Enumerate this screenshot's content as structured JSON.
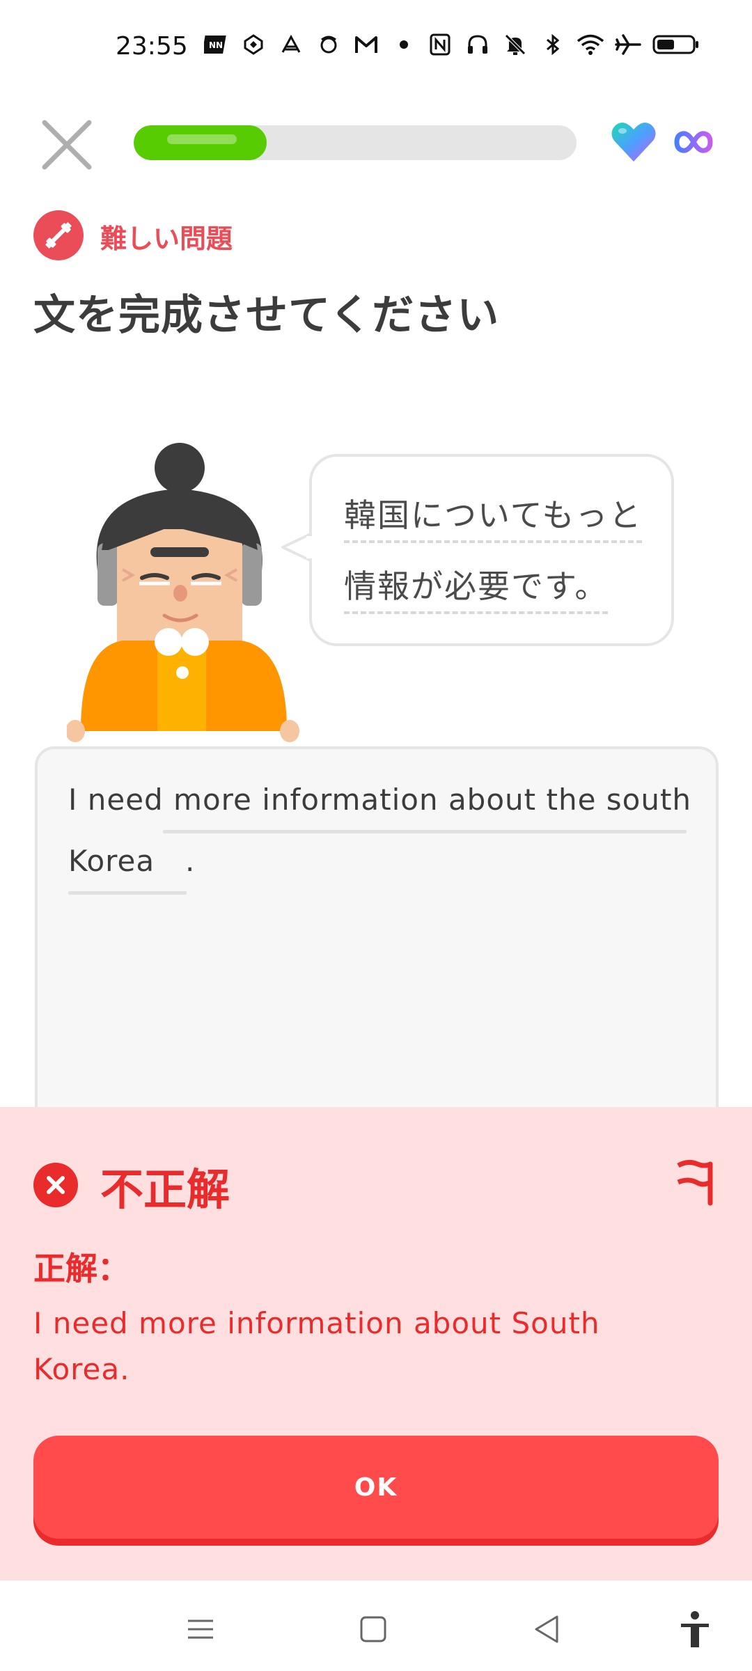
{
  "status_bar": {
    "time": "23:55",
    "left_icons": [
      "nn-app-icon",
      "sync-icon",
      "app-icon",
      "app-icon-2",
      "gmail-icon",
      "dot-icon"
    ],
    "right_icons": [
      "nfc-icon",
      "headphones-icon",
      "mute-icon",
      "bluetooth-icon",
      "wifi-icon",
      "airplane-icon",
      "battery-icon"
    ]
  },
  "header": {
    "progress": 0.3,
    "progress_color": "#58cc02",
    "hearts_icon": "heart-icon",
    "hearts_count": "infinity"
  },
  "challenge": {
    "badge_label": "難しい問題",
    "instruction": "文を完成させてください"
  },
  "prompt": {
    "line1": "韓国についてもっと",
    "line2": "情報が必要です。"
  },
  "answer": {
    "prefix": "I need more information about the south",
    "typed_word": "Korea",
    "suffix": "."
  },
  "feedback": {
    "title": "不正解",
    "correct_label": "正解：",
    "correct_answer": "I need more information about South Korea.",
    "button_label": "OK",
    "accent_color": "#ea2b2b",
    "panel_color": "#ffdfe0"
  },
  "nav_bar": {
    "icons": [
      "menu-icon",
      "home-icon",
      "back-icon",
      "accessibility-icon"
    ]
  }
}
